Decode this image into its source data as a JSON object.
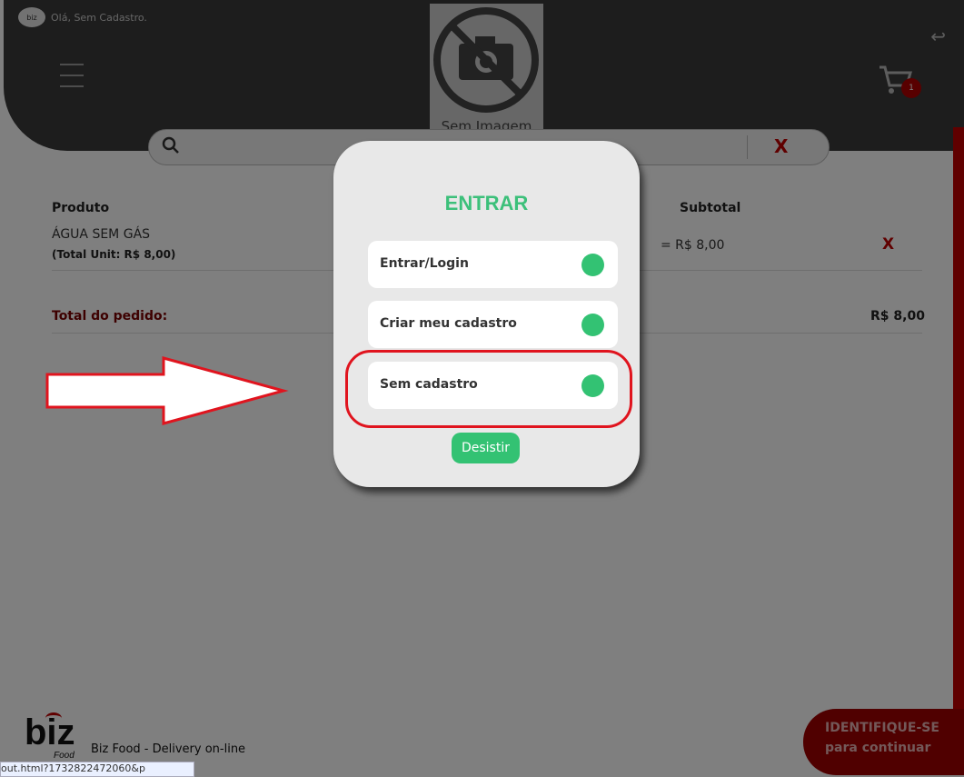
{
  "header": {
    "greeting": "Olá, Sem Cadastro.",
    "logo_small": "biz",
    "no_image_label": "Sem Imagem",
    "cart_count": "1"
  },
  "search": {
    "clear_label": "X",
    "placeholder": ""
  },
  "table": {
    "headers": {
      "product": "Produto",
      "subtotal": "Subtotal"
    },
    "rows": [
      {
        "name": "ÁGUA SEM GÁS",
        "unit": "(Total Unit: R$ 8,00)",
        "subtotal": "= R$ 8,00",
        "remove": "X"
      }
    ],
    "total_label": "Total do pedido:",
    "total_value": "R$ 8,00"
  },
  "modal": {
    "title": "ENTRAR",
    "options": [
      {
        "label": "Entrar/Login"
      },
      {
        "label": "Criar meu cadastro"
      },
      {
        "label": "Sem cadastro"
      }
    ],
    "cancel_label": "Desistir"
  },
  "footer": {
    "brand": "biz",
    "brand_sub": "Food",
    "tagline": "Biz Food - Delivery on-line",
    "cta_line1": "IDENTIFIQUE-SE",
    "cta_line2": "para continuar",
    "status_url": "out.html?1732822472060&p"
  },
  "colors": {
    "accent_green": "#33c273",
    "accent_red": "#c00000",
    "header_dark": "#3a3a3a"
  }
}
